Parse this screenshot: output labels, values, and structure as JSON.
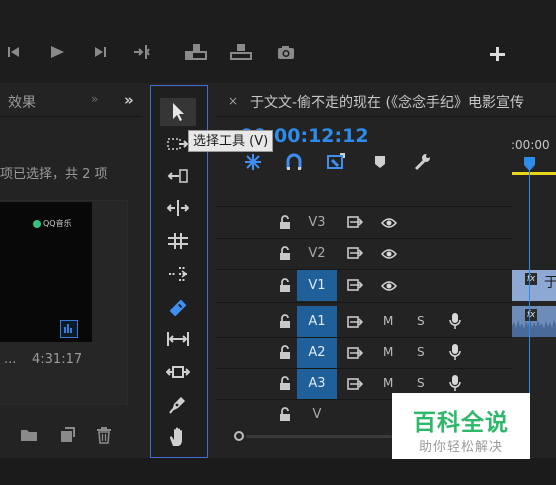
{
  "window": {
    "accent_color": "#2d8ceb",
    "selection_border_color": "#3f6fd6"
  },
  "transport": {
    "icons": [
      "step-back-icon",
      "play-icon",
      "step-forward-icon",
      "insert-icon",
      "lift-icon",
      "extract-icon",
      "camera-icon",
      "add-icon"
    ]
  },
  "left_panel": {
    "tab_effects": "效果",
    "tab_more": "»",
    "overflow_glyph": "»",
    "selection_status": "项已选择，共 2 项",
    "clip": {
      "thumbnail_logo": "QQ音乐",
      "name": "...",
      "duration": "4:31:17"
    },
    "bottom_icons": [
      "folder-icon",
      "new-item-icon",
      "trash-icon"
    ]
  },
  "tools": {
    "tooltip": "选择工具 (V)",
    "items": [
      {
        "name": "selection-tool",
        "icon": "arrow-cursor-icon",
        "active": true
      },
      {
        "name": "track-select-tool",
        "icon": "track-select-icon"
      },
      {
        "name": "ripple-edit-tool",
        "icon": "ripple-edit-icon"
      },
      {
        "name": "rolling-edit-tool",
        "icon": "rolling-edit-icon"
      },
      {
        "name": "rate-stretch-tool",
        "icon": "rate-stretch-icon"
      },
      {
        "name": "razor-tool",
        "icon": "razor-icon"
      },
      {
        "name": "slip-tool",
        "icon": "slip-icon"
      },
      {
        "name": "slide-tool",
        "icon": "slide-icon"
      },
      {
        "name": "pen-tool",
        "icon": "pen-icon"
      },
      {
        "name": "hand-tool",
        "icon": "hand-icon"
      }
    ]
  },
  "timeline": {
    "close_glyph": "×",
    "sequence_title": "于文文-偷不走的现在 (《念念手纪》电影宣传",
    "timecode": "00:00:12:12",
    "ruler_time": ":00:00",
    "controls": [
      "snap-icon",
      "linked-selection-icon",
      "add-marker-icon",
      "marker-icon",
      "wrench-icon"
    ],
    "tracks": [
      {
        "id": "V3",
        "type": "video",
        "targeted": false
      },
      {
        "id": "V2",
        "type": "video",
        "targeted": false
      },
      {
        "id": "V1",
        "type": "video",
        "targeted": true,
        "clip_label": "于"
      },
      {
        "id": "A1",
        "type": "audio",
        "targeted": true,
        "mute": "M",
        "solo": "S"
      },
      {
        "id": "A2",
        "type": "audio",
        "targeted": true,
        "mute": "M",
        "solo": "S"
      },
      {
        "id": "A3",
        "type": "audio",
        "targeted": true,
        "mute": "M",
        "solo": "S"
      },
      {
        "id": "V",
        "type": "empty",
        "targeted": false
      }
    ],
    "fx_badge": "fx"
  },
  "watermark": {
    "title": "百科全说",
    "subtitle": "助你轻松解决"
  }
}
